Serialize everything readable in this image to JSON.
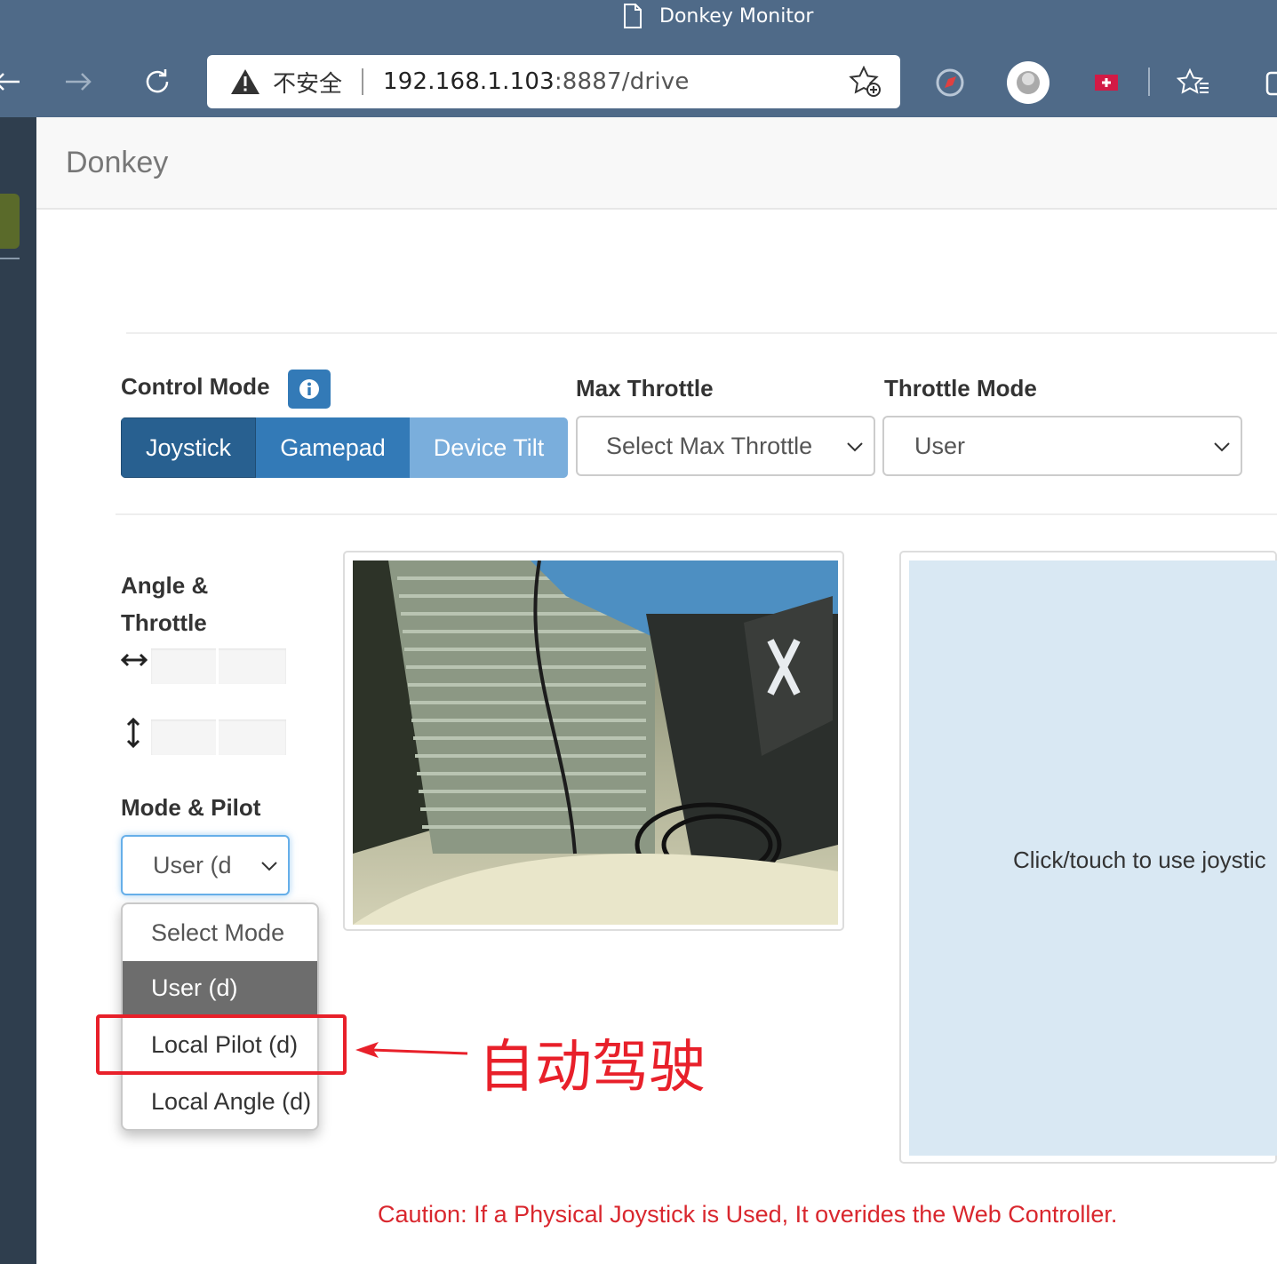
{
  "browser": {
    "window_title": "Donkey Monitor",
    "insecure_label": "不安全",
    "url_host": "192.168.1.103",
    "url_rest": ":8887/drive"
  },
  "navbar": {
    "brand": "Donkey"
  },
  "control": {
    "control_mode_label": "Control Mode",
    "buttons": [
      "Joystick",
      "Gamepad",
      "Device Tilt"
    ],
    "max_throttle_label": "Max Throttle",
    "max_throttle_value": "Select Max Throttle",
    "throttle_mode_label": "Throttle Mode",
    "throttle_mode_value": "User"
  },
  "status": {
    "angle_throttle_line1": "Angle &",
    "angle_throttle_line2": "Throttle",
    "mode_pilot_label": "Mode & Pilot",
    "mode_select_value": "User (d"
  },
  "mode_dropdown": {
    "options": [
      "Select Mode",
      "User (d)",
      "Local Pilot (d)",
      "Local Angle (d)"
    ],
    "selected": "User (d)"
  },
  "joystick": {
    "prompt": "Click/touch to use joystic"
  },
  "annotation": {
    "text": "自动驾驶",
    "color": "#e8202a"
  },
  "caution": "Caution: If a Physical Joystick is Used, It overides the Web Controller.",
  "colors": {
    "primary": "#337ab7",
    "active": "#286090",
    "disabled": "#7aaedc",
    "joy_bg": "#d9e8f3",
    "caution": "#d9272e"
  }
}
